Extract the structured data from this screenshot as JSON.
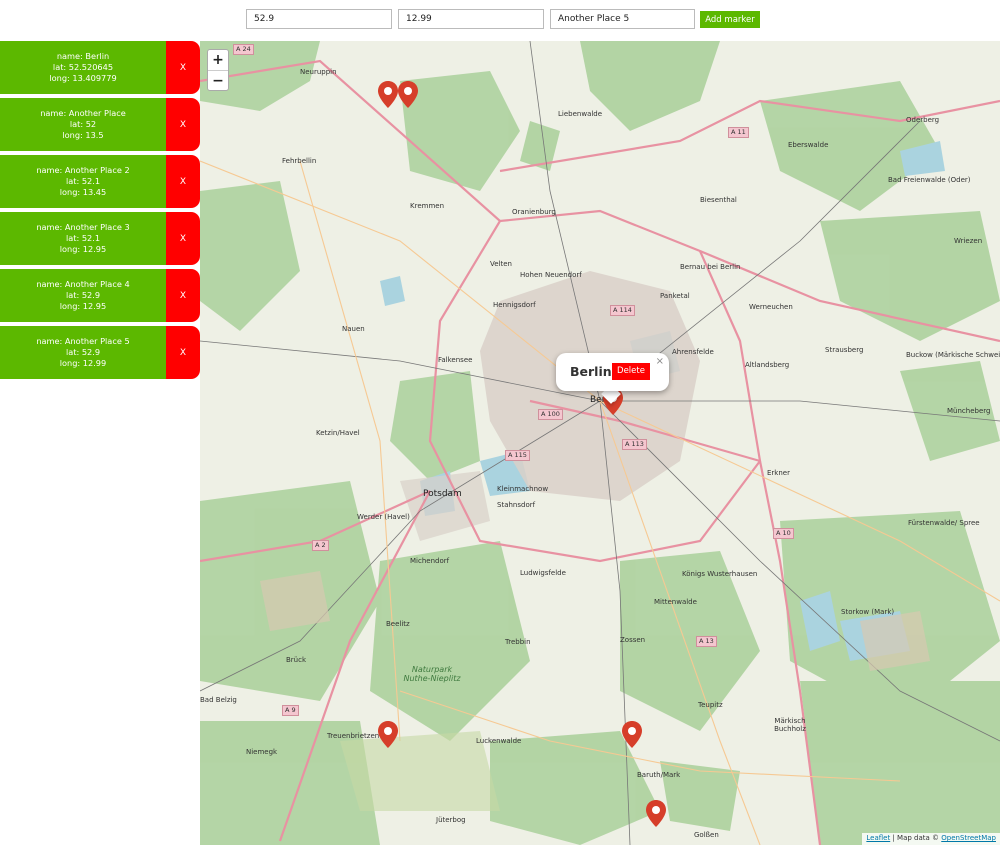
{
  "form": {
    "lat_value": "52.9",
    "lng_value": "12.99",
    "name_value": "Another Place 5",
    "add_label": "Add marker"
  },
  "places": [
    {
      "name": "name: Berlin",
      "lat": "lat: 52.520645",
      "long": "long: 13.409779",
      "delete_label": "X"
    },
    {
      "name": "name: Another Place",
      "lat": "lat: 52",
      "long": "long: 13.5",
      "delete_label": "X"
    },
    {
      "name": "name: Another Place 2",
      "lat": "lat: 52.1",
      "long": "long: 13.45",
      "delete_label": "X"
    },
    {
      "name": "name: Another Place 3",
      "lat": "lat: 52.1",
      "long": "long: 12.95",
      "delete_label": "X"
    },
    {
      "name": "name: Another Place 4",
      "lat": "lat: 52.9",
      "long": "long: 12.95",
      "delete_label": "X"
    },
    {
      "name": "name: Another Place 5",
      "lat": "lat: 52.9",
      "long": "long: 12.99",
      "delete_label": "X"
    }
  ],
  "map": {
    "zoom_in": "+",
    "zoom_out": "−",
    "popup": {
      "title": "Berlin",
      "delete_label": "Delete",
      "close": "×"
    },
    "attribution": {
      "leaflet": "Leaflet",
      "separator": " | Map data © ",
      "osm": "OpenStreetMap"
    },
    "labels": {
      "neuruppin": "Neuruppin",
      "oranienburg": "Oranienburg",
      "potsdam": "Potsdam",
      "berlin": "Berlin",
      "nauen": "Nauen",
      "falkensee": "Falkensee",
      "velten": "Velten",
      "hennigsdorf": "Hennigsdorf",
      "eberswalde": "Eberswalde",
      "bernau": "Bernau bei Berlin",
      "strausberg": "Strausberg",
      "erkner": "Erkner",
      "ketzin": "Ketzin/Havel",
      "werder": "Werder (Havel)",
      "michendorf": "Michendorf",
      "ludwigsfelde": "Ludwigsfelde",
      "zossen": "Zossen",
      "trebbin": "Trebbin",
      "beelitz": "Beelitz",
      "bruck": "Brück",
      "treuenbrietzen": "Treuenbrietzen",
      "luckenwalde": "Luckenwalde",
      "juterbog": "Jüterbog",
      "baruth": "Baruth/Mark",
      "golssen": "Golßen",
      "teupitz": "Teupitz",
      "mittenwalde": "Mittenwalde",
      "konigs": "Königs Wusterhausen",
      "stahnsdorf": "Stahnsdorf",
      "kleinmachnow": "Kleinmachnow",
      "fehrbellin": "Fehrbellin",
      "kremmen": "Kremmen",
      "liebenwalde": "Liebenwalde",
      "odernberg": "Oderberg",
      "biesenthal": "Biesenthal",
      "werneuchen": "Werneuchen",
      "altlandsberg": "Altlandsberg",
      "ahrensfelde": "Ahrensfelde",
      "panketal": "Panketal",
      "muncheberg": "Müncheberg",
      "furstenwalde": "Fürstenwalde/ Spree",
      "storkow": "Storkow (Mark)",
      "niemegk": "Niemegk",
      "badbelzig": "Bad Belzig",
      "markisch": "Märkisch Buchholz",
      "buckow": "Buckow (Märkische Schweiz)",
      "badfreienwalde": "Bad Freienwalde (Oder)",
      "wriezen": "Wriezen",
      "hohen": "Hohen Neuendorf",
      "naturpark": "Naturpark Nuthe-Nieplitz"
    },
    "shields": [
      "A 24",
      "A 11",
      "A 114",
      "A 100",
      "A 115",
      "A 113",
      "A 10",
      "A 2",
      "A 9",
      "A 13"
    ]
  }
}
